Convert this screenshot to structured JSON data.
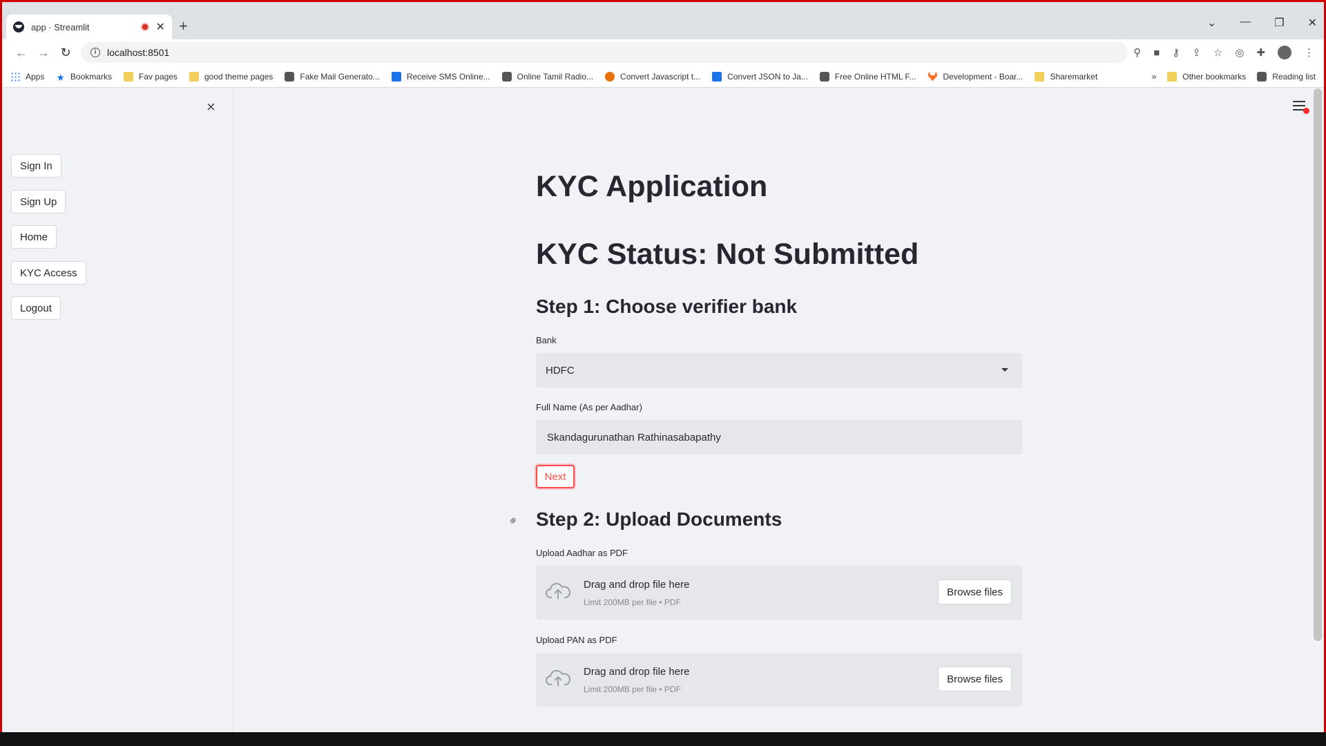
{
  "browser": {
    "tab_title": "app · Streamlit",
    "url": "localhost:8501",
    "bookmarks": [
      {
        "label": "Apps",
        "icon": "apps-grid-icon"
      },
      {
        "label": "Bookmarks",
        "icon": "star-icon"
      },
      {
        "label": "Fav pages",
        "icon": "folder-icon"
      },
      {
        "label": "good theme pages",
        "icon": "folder-icon"
      },
      {
        "label": "Fake Mail Generato...",
        "icon": "mail-icon"
      },
      {
        "label": "Receive SMS Online...",
        "icon": "sms-icon"
      },
      {
        "label": "Online Tamil Radio...",
        "icon": "radio-icon"
      },
      {
        "label": "Convert Javascript t...",
        "icon": "convert-icon"
      },
      {
        "label": "Convert JSON to Ja...",
        "icon": "json-icon"
      },
      {
        "label": "Free Online HTML F...",
        "icon": "html-icon"
      },
      {
        "label": "Development - Boar...",
        "icon": "gitlab-icon"
      },
      {
        "label": "Sharemarket",
        "icon": "folder-icon"
      }
    ],
    "overflow_label": "»",
    "other_bookmarks": "Other bookmarks",
    "reading_list": "Reading list"
  },
  "sidebar": {
    "close_icon": "×",
    "buttons": [
      "Sign In",
      "Sign Up",
      "Home",
      "KYC Access",
      "Logout"
    ]
  },
  "main": {
    "title": "KYC Application",
    "status": "KYC Status: Not Submitted",
    "step1": {
      "heading": "Step 1: Choose verifier bank",
      "bank_label": "Bank",
      "bank_value": "HDFC",
      "name_label": "Full Name (As per Aadhar)",
      "name_value": "Skandagurunathan Rathinasabapathy",
      "next_label": "Next"
    },
    "step2": {
      "heading": "Step 2: Upload Documents",
      "uploads": [
        {
          "label": "Upload Aadhar as PDF",
          "drop_text": "Drag and drop file here",
          "limit_text": "Limit 200MB per file • PDF",
          "browse_label": "Browse files"
        },
        {
          "label": "Upload PAN as PDF",
          "drop_text": "Drag and drop file here",
          "limit_text": "Limit 200MB per file • PDF",
          "browse_label": "Browse files"
        }
      ]
    }
  },
  "colors": {
    "accent": "#ff4b4b",
    "background": "#f0f2f6",
    "input_bg": "#e6e7eb",
    "text": "#262730",
    "frame_border": "#d10000"
  }
}
